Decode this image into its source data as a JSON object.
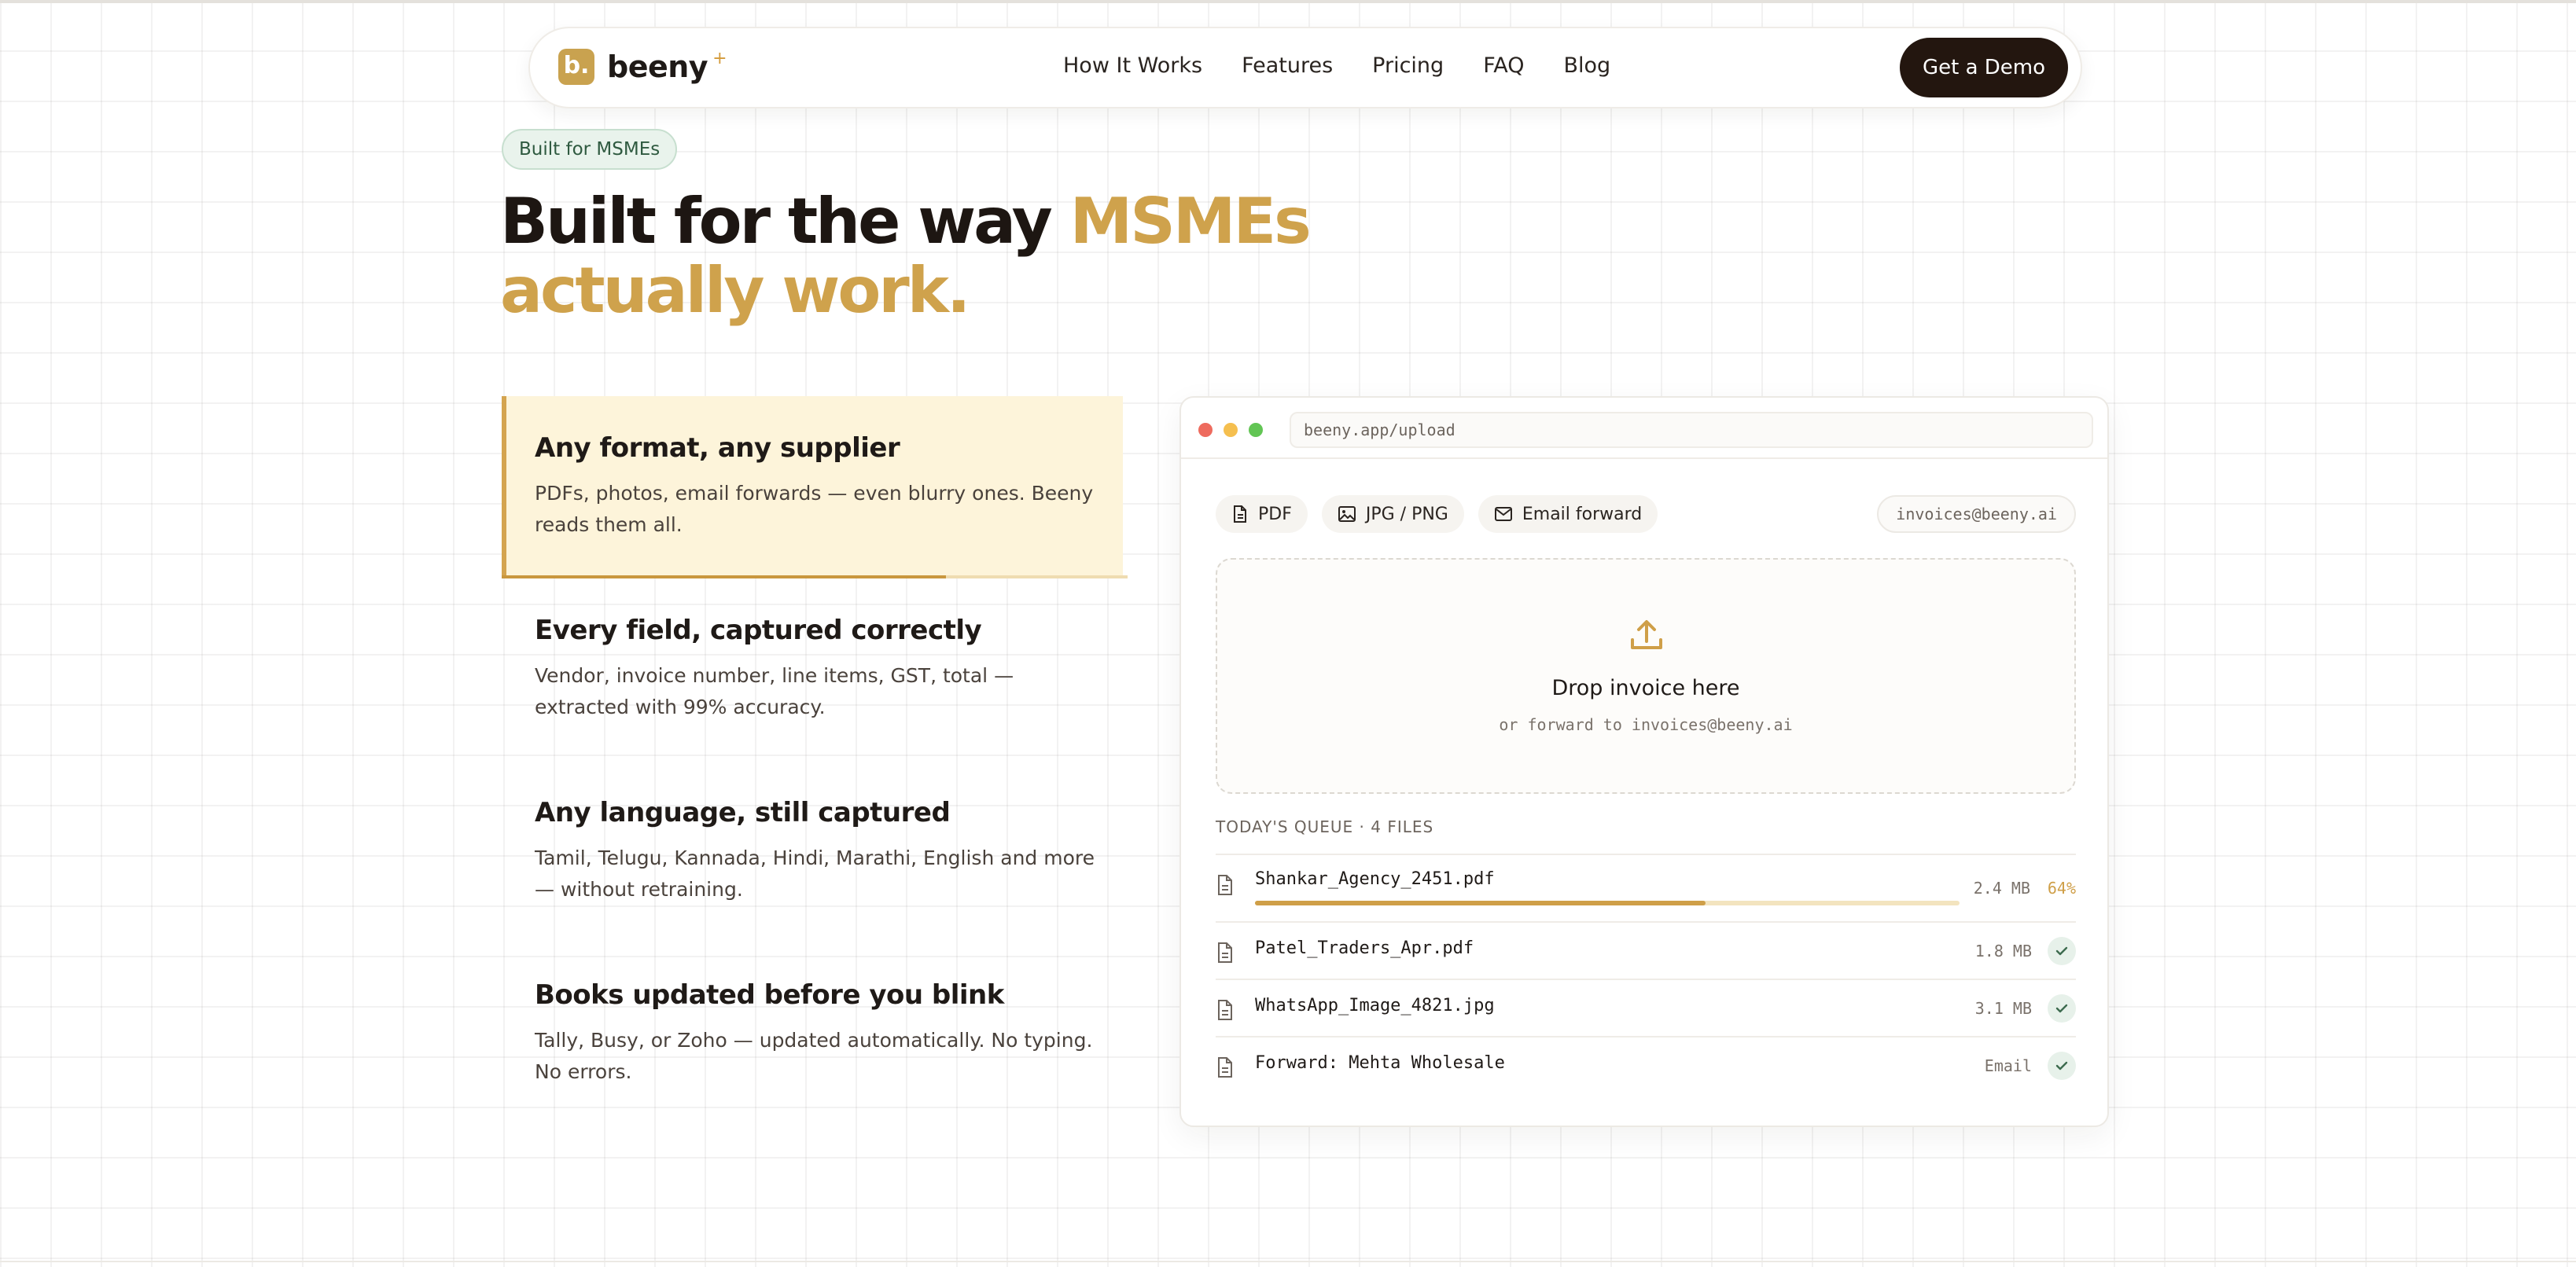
{
  "nav": {
    "logo_mark": "b.",
    "logo_text": "beeny",
    "logo_spark": "+",
    "links": [
      "How It Works",
      "Features",
      "Pricing",
      "FAQ",
      "Blog"
    ],
    "cta": "Get a Demo"
  },
  "hero": {
    "badge": "Built for MSMEs",
    "headline_plain": "Built for the way ",
    "headline_accent": "MSMEs actually work."
  },
  "features": [
    {
      "title": "Any format, any supplier",
      "desc": "PDFs, photos, email forwards — even blurry ones. Beeny reads them all.",
      "active": true,
      "progress": 0.71
    },
    {
      "title": "Every field, captured correctly",
      "desc": "Vendor, invoice number, line items, GST, total — extracted with 99% accuracy."
    },
    {
      "title": "Any language, still captured",
      "desc": "Tamil, Telugu, Kannada, Hindi, Marathi, English and more — without retraining."
    },
    {
      "title": "Books updated before you blink",
      "desc": "Tally, Busy, or Zoho — updated automatically. No typing. No errors."
    }
  ],
  "upload": {
    "url": "beeny.app/upload",
    "chips": [
      {
        "label": "PDF",
        "icon": "document-icon"
      },
      {
        "label": "JPG / PNG",
        "icon": "image-icon"
      },
      {
        "label": "Email forward",
        "icon": "mail-icon"
      }
    ],
    "email": "invoices@beeny.ai",
    "drop_title": "Drop invoice here",
    "drop_sub": "or forward to invoices@beeny.ai",
    "queue_title": "TODAY'S QUEUE · 4 FILES",
    "queue": [
      {
        "name": "Shankar_Agency_2451.pdf",
        "size": "2.4 MB",
        "progress_label": "64%",
        "progress": 0.64,
        "done": false
      },
      {
        "name": "Patel_Traders_Apr.pdf",
        "size": "1.8 MB",
        "done": true
      },
      {
        "name": "WhatsApp_Image_4821.jpg",
        "size": "3.1 MB",
        "done": true
      },
      {
        "name": "Forward: Mehta Wholesale",
        "size": "Email",
        "done": true
      }
    ]
  },
  "colors": {
    "accent": "#cfa24c",
    "dark": "#23160f",
    "badge_green": "#2f5a40",
    "feature_active_bg": "#fdf4da"
  }
}
